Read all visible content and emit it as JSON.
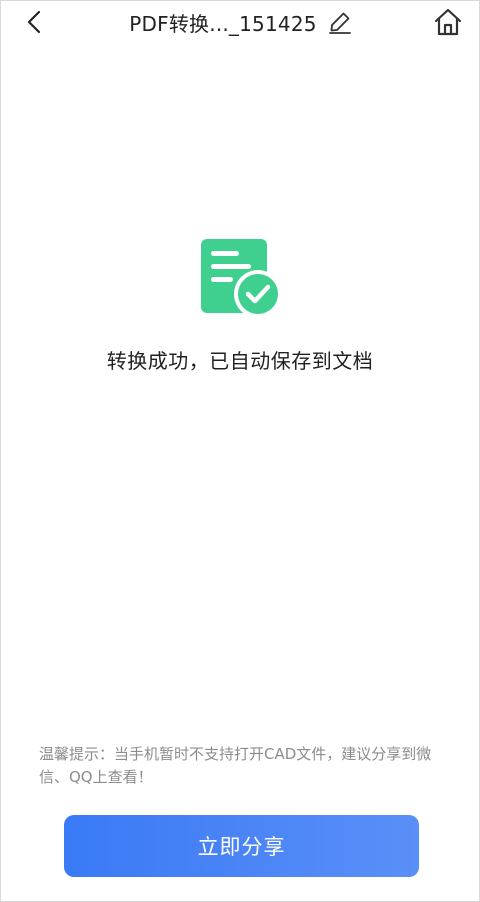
{
  "header": {
    "title": "PDF转换..._151425",
    "back_icon": "chevron-left-icon",
    "edit_icon": "pencil-icon",
    "home_icon": "home-icon"
  },
  "main": {
    "status_icon": "document-check-icon",
    "status_text": "转换成功，已自动保存到文档"
  },
  "tip": {
    "text": "温馨提示：当手机暂时不支持打开CAD文件，建议分享到微信、QQ上查看！"
  },
  "actions": {
    "share_label": "立即分享"
  },
  "colors": {
    "accent_start": "#3a7af6",
    "accent_end": "#5a8ff7",
    "success_green": "#3fcf8e",
    "tip_gray": "#8c8c8c"
  }
}
